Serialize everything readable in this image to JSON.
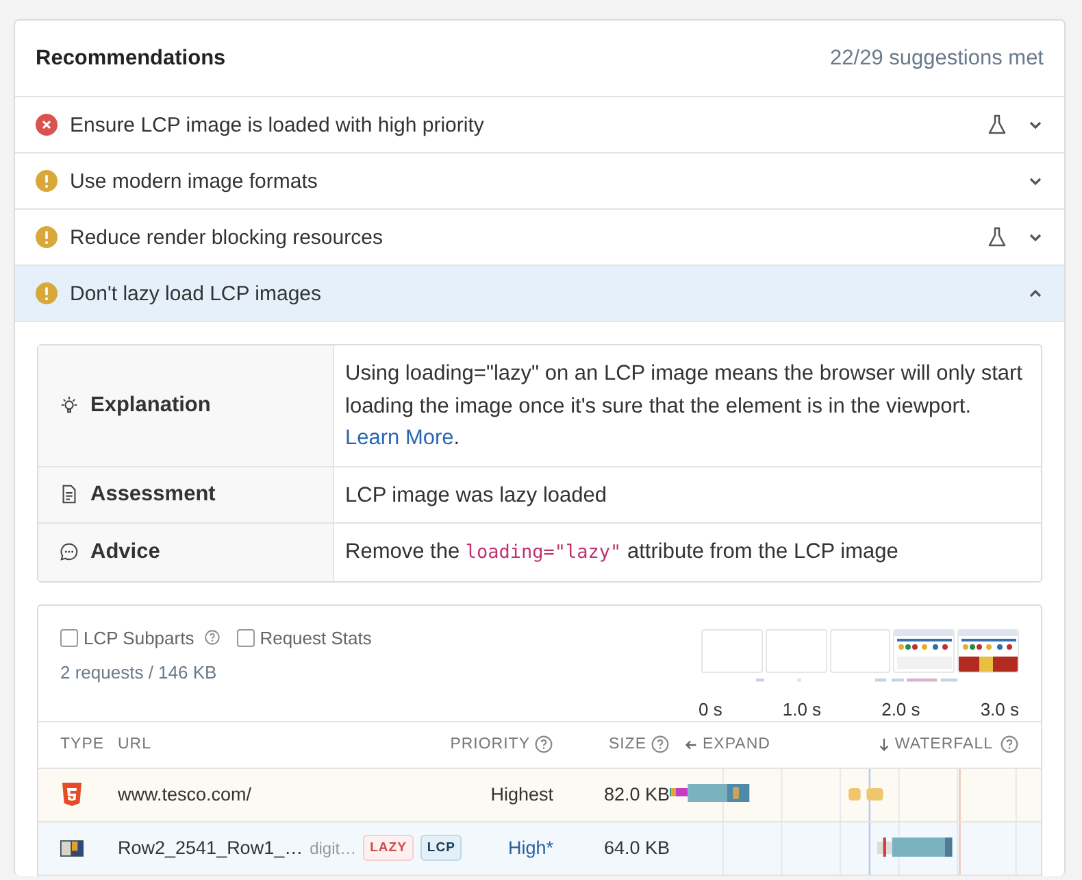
{
  "recommendations": {
    "title": "Recommendations",
    "summary": "22/29 suggestions met",
    "items": [
      {
        "kind": "error",
        "title": "Ensure LCP image is loaded with high priority",
        "experiment": true,
        "expanded": false
      },
      {
        "kind": "warning",
        "title": "Use modern image formats",
        "experiment": false,
        "expanded": false
      },
      {
        "kind": "warning",
        "title": "Reduce render blocking resources",
        "experiment": true,
        "expanded": false
      },
      {
        "kind": "warning",
        "title": "Don't lazy load LCP images",
        "experiment": false,
        "expanded": true
      }
    ]
  },
  "details": [
    {
      "kind": "explanation",
      "label": "Explanation",
      "text": "Using loading=\"lazy\" on an LCP image means the browser will only start loading the image once it's sure that the element is in the viewport.",
      "link": "Learn More",
      "after": "."
    },
    {
      "kind": "assessment",
      "label": "Assessment",
      "text": "LCP image was lazy loaded"
    },
    {
      "kind": "advice",
      "label": "Advice",
      "text": "Remove the ",
      "code": "loading=\"lazy\"",
      "after": " attribute from the LCP image"
    }
  ],
  "requests": {
    "options": [
      {
        "label": "LCP Subparts",
        "checked": false,
        "help": true
      },
      {
        "label": "Request Stats",
        "checked": false,
        "help": false
      }
    ],
    "summary": "2 requests / 146 KB",
    "filmstrip": [
      {
        "kind": "blank"
      },
      {
        "kind": "blank"
      },
      {
        "kind": "blank"
      },
      {
        "kind": "picture"
      },
      {
        "kind": "picture"
      }
    ],
    "time_labels": [
      "0 s",
      "1.0 s",
      "2.0 s",
      "3.0 s"
    ],
    "columns": {
      "type": "TYPE",
      "url": "URL",
      "priority": "PRIORITY",
      "size": "SIZE",
      "expand": "EXPAND",
      "waterfall": "WATERFALL"
    },
    "rows": [
      {
        "kind": "document",
        "url": "www.tesco.com/",
        "priority": "Highest",
        "size": "82.0 KB"
      },
      {
        "kind": "lcp-image",
        "url": "Row2_2541_Row1_…",
        "domain": "digit…",
        "badges": [
          {
            "kind": "lazy",
            "label": "LAZY"
          },
          {
            "kind": "lcp",
            "label": "LCP"
          }
        ],
        "priority": "High*",
        "size": "64.0 KB"
      }
    ]
  }
}
